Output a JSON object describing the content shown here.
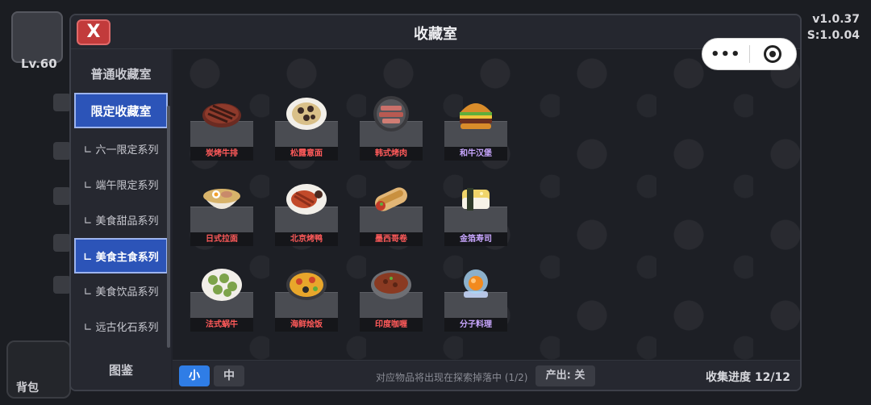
{
  "hud": {
    "level": "Lv.60",
    "version_line1": "v1.0.37",
    "version_line2": "S:1.0.04",
    "bag_label": "背包"
  },
  "dialog": {
    "title": "收藏室",
    "close_label": "X"
  },
  "sidebar": {
    "items": [
      {
        "label": "普通收藏室",
        "kind": "top",
        "active": false
      },
      {
        "label": "限定收藏室",
        "kind": "top",
        "active": true
      },
      {
        "label": "∟ 六一限定系列",
        "kind": "sub",
        "active": false
      },
      {
        "label": "∟ 端午限定系列",
        "kind": "sub",
        "active": false
      },
      {
        "label": "∟ 美食甜品系列",
        "kind": "sub",
        "active": false
      },
      {
        "label": "∟ 美食主食系列",
        "kind": "sub",
        "active": true
      },
      {
        "label": "∟ 美食饮品系列",
        "kind": "sub",
        "active": false
      },
      {
        "label": "∟ 远古化石系列",
        "kind": "sub",
        "active": false
      }
    ],
    "handbook_label": "图鉴"
  },
  "items": [
    {
      "name": "炭烤牛排",
      "icon": "steak-icon",
      "color": "red"
    },
    {
      "name": "松露意面",
      "icon": "pasta-icon",
      "color": "red"
    },
    {
      "name": "韩式烤肉",
      "icon": "korean-bbq-icon",
      "color": "red"
    },
    {
      "name": "和牛汉堡",
      "icon": "burger-icon",
      "color": "purple"
    },
    {
      "name": "日式拉面",
      "icon": "ramen-icon",
      "color": "red"
    },
    {
      "name": "北京烤鸭",
      "icon": "roast-duck-icon",
      "color": "red"
    },
    {
      "name": "墨西哥卷",
      "icon": "burrito-icon",
      "color": "red"
    },
    {
      "name": "金箔寿司",
      "icon": "sushi-icon",
      "color": "purple"
    },
    {
      "name": "法式蜗牛",
      "icon": "escargot-icon",
      "color": "red"
    },
    {
      "name": "海鲜烩饭",
      "icon": "paella-icon",
      "color": "red"
    },
    {
      "name": "印度咖喱",
      "icon": "curry-icon",
      "color": "red"
    },
    {
      "name": "分子料理",
      "icon": "molecular-dish-icon",
      "color": "purple"
    }
  ],
  "bottom": {
    "size_small": "小",
    "size_mid": "中",
    "hint": "对应物品将出现在探索掉落中 (1/2)",
    "output_label": "产出: 关",
    "progress_label": "收集进度 12/12",
    "selected_size": "小"
  },
  "colors": {
    "accent_blue": "#2c54b8",
    "close_red": "#c23b3b",
    "name_red": "#ff5a5a",
    "name_purple": "#c9a7ff"
  }
}
